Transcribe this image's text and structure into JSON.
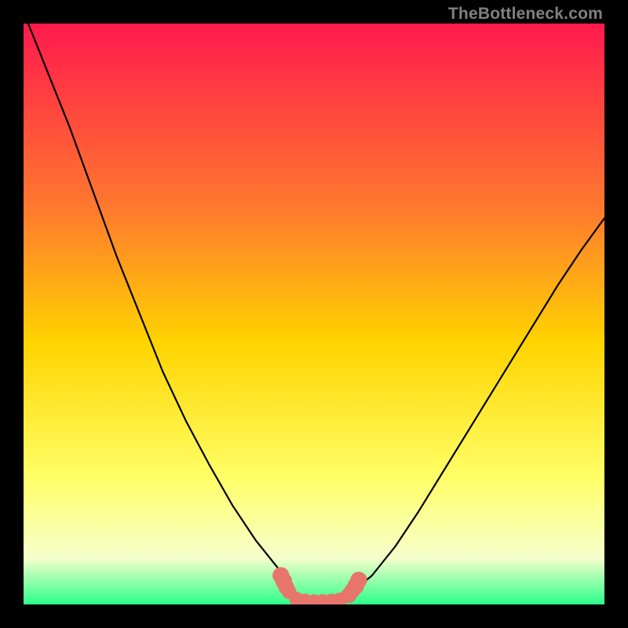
{
  "attribution": "TheBottleneck.com",
  "colors": {
    "gradient_top": "#ff1a4d",
    "gradient_mid_upper": "#ff7a2e",
    "gradient_mid": "#ffd400",
    "gradient_mid_lower": "#ffff66",
    "gradient_near_bottom": "#f6ffcc",
    "gradient_bottom": "#2cff8a",
    "curve_stroke": "#000000",
    "marker_fill": "#e8756c",
    "frame": "#000000"
  },
  "chart_data": {
    "type": "line",
    "title": "",
    "xlabel": "",
    "ylabel": "",
    "xlim": [
      0,
      100
    ],
    "ylim": [
      0,
      100
    ],
    "series": [
      {
        "name": "left-branch",
        "x": [
          0,
          4,
          8,
          12,
          16,
          20,
          24,
          28,
          32,
          36,
          40,
          42,
          44,
          45,
          46,
          46.5
        ],
        "y": [
          102,
          92,
          82,
          71,
          60,
          50,
          40,
          31.5,
          24,
          17,
          11,
          8.5,
          6,
          4.5,
          3,
          2
        ]
      },
      {
        "name": "valley-floor",
        "x": [
          46.5,
          48,
          50,
          52,
          54,
          55,
          56,
          57
        ],
        "y": [
          2,
          1,
          0.5,
          0.5,
          1,
          1.5,
          2,
          2.5
        ]
      },
      {
        "name": "right-branch",
        "x": [
          57,
          60,
          64,
          68,
          72,
          76,
          80,
          84,
          88,
          92,
          96,
          100
        ],
        "y": [
          2.5,
          5,
          10,
          16,
          22.5,
          29,
          35.5,
          42,
          48.5,
          55,
          61,
          66.5
        ]
      }
    ],
    "markers": {
      "name": "valley-markers",
      "points": [
        {
          "x": 44.3,
          "y": 5.0,
          "r": 1.0
        },
        {
          "x": 44.8,
          "y": 4.0,
          "r": 1.0
        },
        {
          "x": 45.2,
          "y": 3.0,
          "r": 0.9
        },
        {
          "x": 45.7,
          "y": 2.2,
          "r": 0.8
        },
        {
          "x": 47.0,
          "y": 0.9,
          "r": 0.8
        },
        {
          "x": 48.5,
          "y": 0.6,
          "r": 0.8
        },
        {
          "x": 50.0,
          "y": 0.5,
          "r": 0.8
        },
        {
          "x": 51.5,
          "y": 0.5,
          "r": 0.8
        },
        {
          "x": 53.0,
          "y": 0.6,
          "r": 0.8
        },
        {
          "x": 54.5,
          "y": 0.8,
          "r": 0.8
        },
        {
          "x": 56.0,
          "y": 1.6,
          "r": 0.9
        },
        {
          "x": 56.6,
          "y": 2.4,
          "r": 0.9
        },
        {
          "x": 57.2,
          "y": 3.2,
          "r": 1.0
        },
        {
          "x": 57.7,
          "y": 4.2,
          "r": 1.0
        }
      ]
    }
  }
}
